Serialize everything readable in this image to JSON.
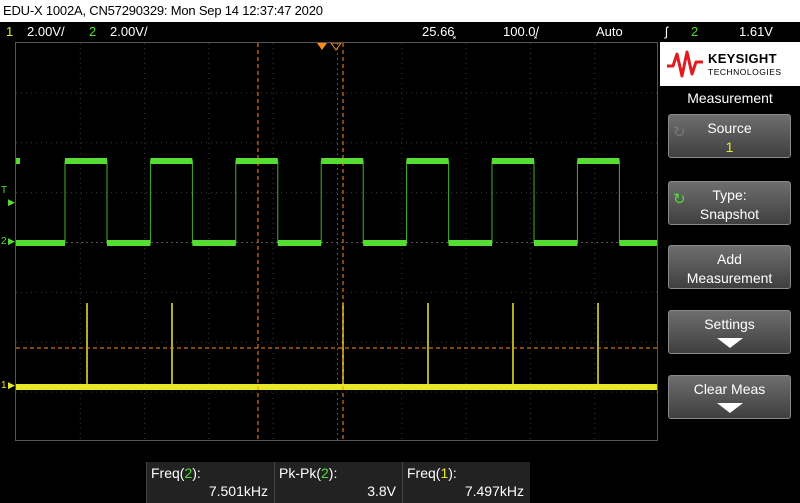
{
  "title_bar": "EDU-X 1002A, CN57290329: Mon Sep 14 12:37:47 2020",
  "status": {
    "ch1_num": "1",
    "ch1_scale": "2.00V/",
    "ch2_num": "2",
    "ch2_scale": "2.00V/",
    "time_scale": "25.66͓",
    "sample_rate": "100.0͓/",
    "mode": "Auto",
    "trigger_icon": "ʃ",
    "trigger_channel": "2",
    "trigger_level": "1.61V"
  },
  "screen": {
    "ch1_marker": "1",
    "ch2_marker": "2",
    "trigger_marker": "T"
  },
  "panel": {
    "brand": "KEYSIGHT",
    "brand_sub": "TECHNOLOGIES",
    "title": "Measurement",
    "source_label": "Source",
    "source_value": "1",
    "type_label": "Type:",
    "type_value": "Snapshot",
    "add_line1": "Add",
    "add_line2": "Measurement",
    "settings_label": "Settings",
    "clear_label": "Clear Meas"
  },
  "measurements": [
    {
      "label_prefix": "Freq(",
      "channel": "2",
      "label_suffix": "):",
      "value": "7.501kHz"
    },
    {
      "label_prefix": "Pk-Pk(",
      "channel": "2",
      "label_suffix": "):",
      "value": "3.8V"
    },
    {
      "label_prefix": "Freq(",
      "channel": "1",
      "label_suffix": "):",
      "value": "7.497kHz"
    }
  ],
  "colors": {
    "ch1": "#e8e82a",
    "ch2": "#55dd33",
    "cursor": "#ff8c1a"
  },
  "icons": {
    "keysight_logo": "wave-logo-icon",
    "source_icon": "rotate-icon",
    "type_icon": "rotate-icon",
    "down_arrow": "down-arrow-icon"
  }
}
